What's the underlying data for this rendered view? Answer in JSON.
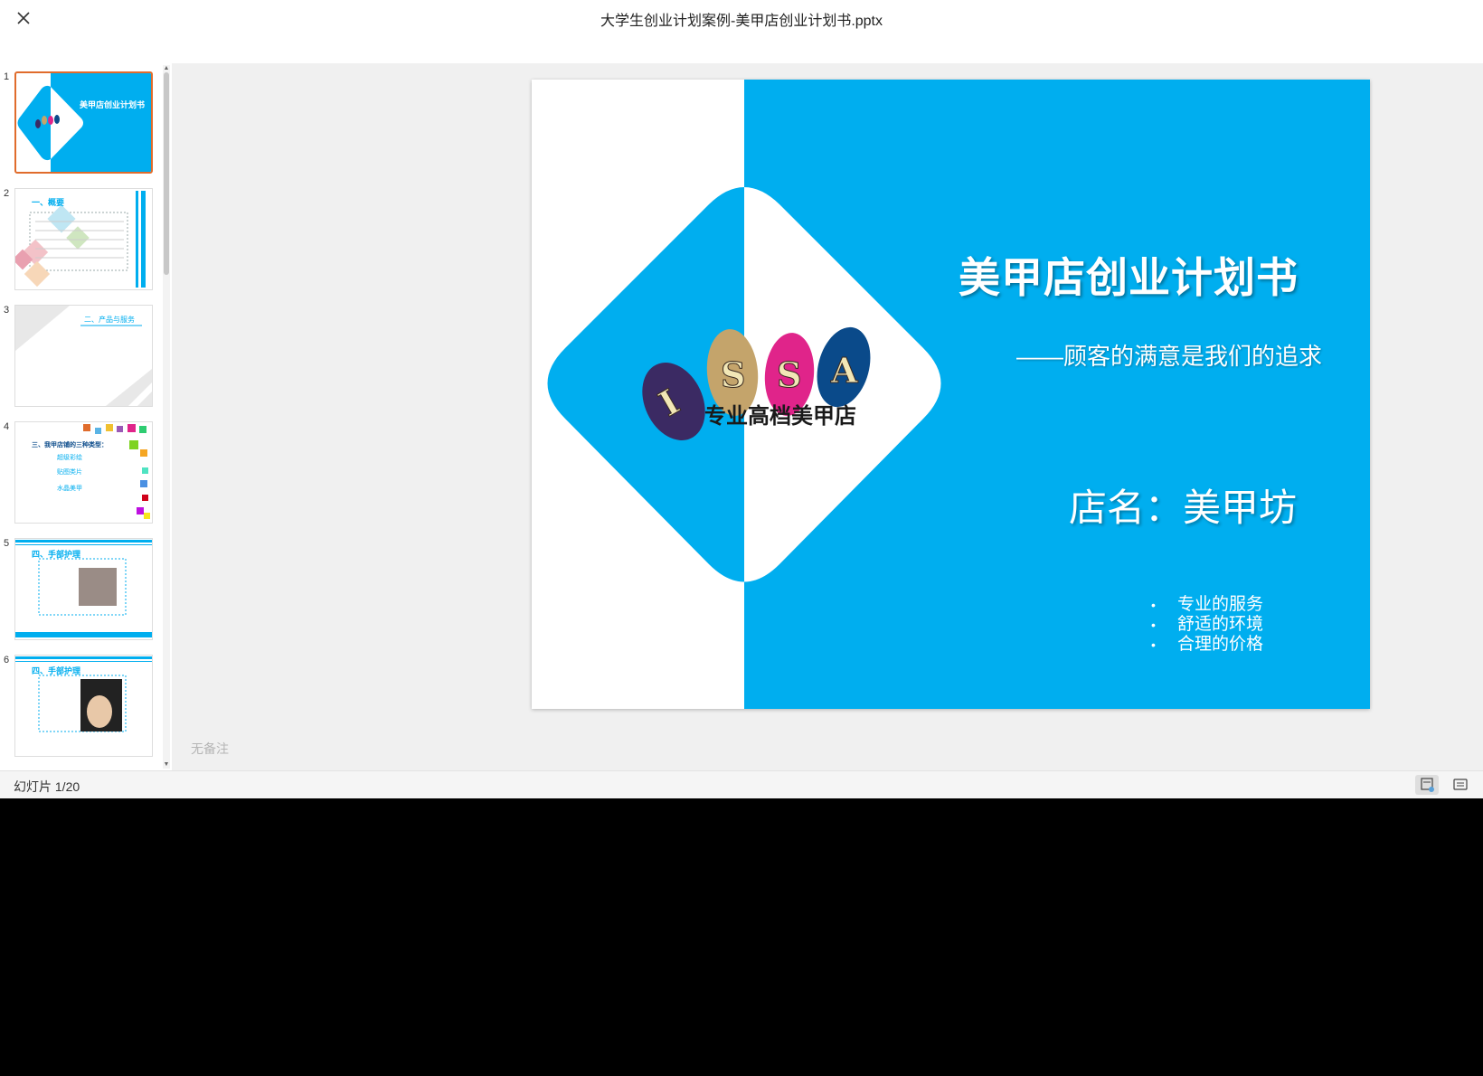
{
  "window": {
    "title": "大学生创业计划案例-美甲店创业计划书.pptx"
  },
  "colors": {
    "slide_blue": "#00aeef",
    "selected_border": "#e06c2c"
  },
  "thumbnails": [
    {
      "number": "1",
      "title": "美甲店创业计划书",
      "selected": true
    },
    {
      "number": "2",
      "title": "一、概要"
    },
    {
      "number": "3",
      "title": "二、产品与服务"
    },
    {
      "number": "4",
      "title": "三、我甲店铺的三种类型：",
      "items": [
        "超级彩绘",
        "贴图类片",
        "水晶美甲"
      ]
    },
    {
      "number": "5",
      "title": "四、手部护理"
    },
    {
      "number": "6",
      "title": "四、手部护理"
    }
  ],
  "slide": {
    "title": "美甲店创业计划书",
    "subtitle": "——顾客的满意是我们的追求",
    "shop_name": "店名：美甲坊",
    "bullets": [
      "专业的服务",
      "舒适的环境",
      "合理的价格"
    ],
    "logo": {
      "letters": [
        "I",
        "S",
        "S",
        "A"
      ],
      "colors": [
        "#3b2a63",
        "#c4a46b",
        "#e0248a",
        "#0a4a8a"
      ],
      "tagline": "专业高档美甲店"
    }
  },
  "notes": {
    "placeholder": "无备注"
  },
  "status": {
    "slide_counter": "幻灯片 1/20"
  }
}
